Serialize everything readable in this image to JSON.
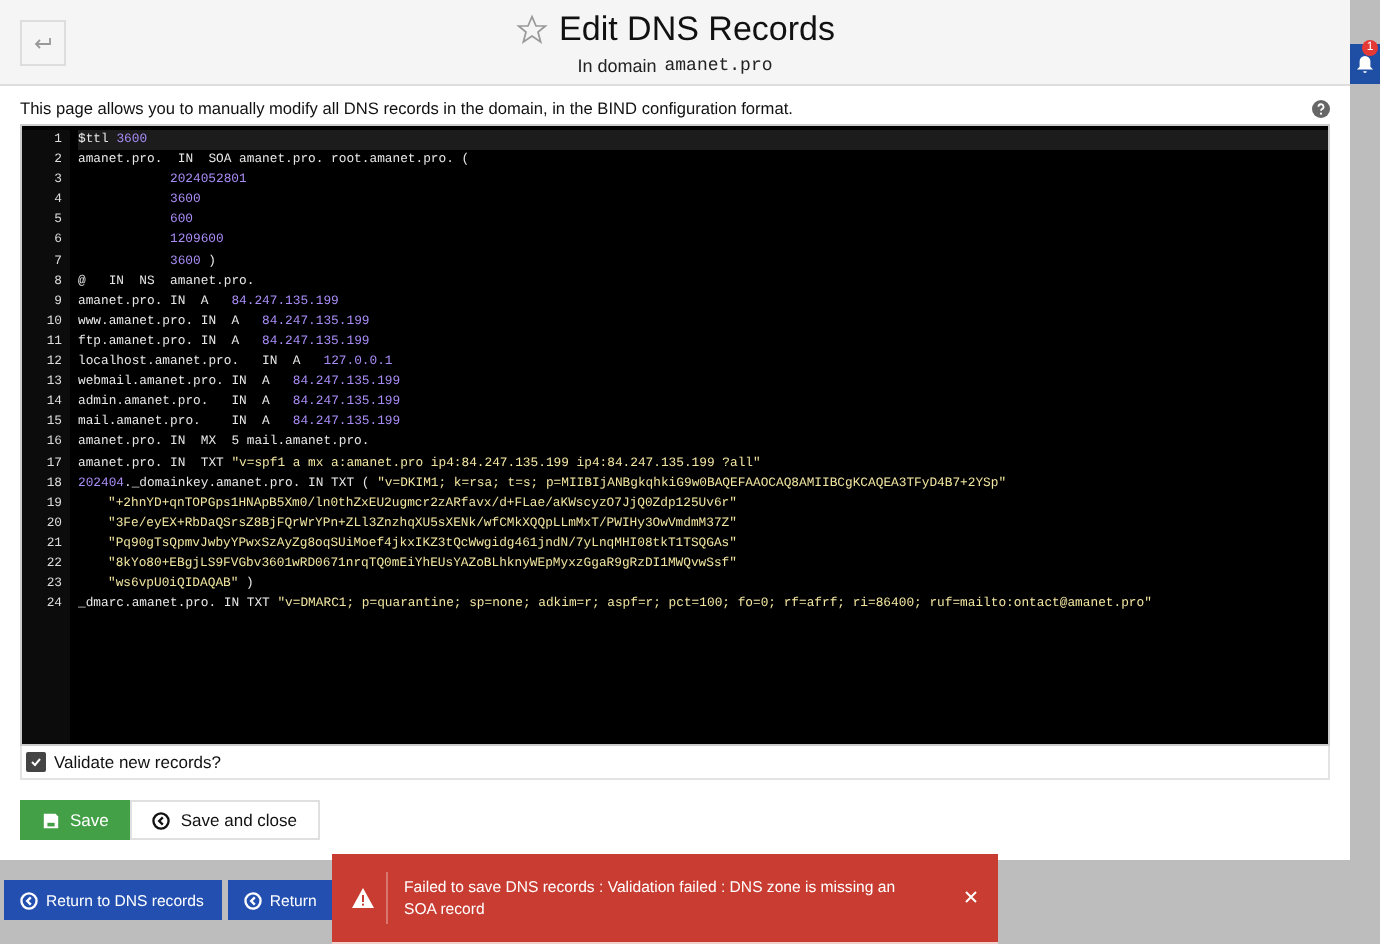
{
  "header": {
    "title": "Edit DNS Records",
    "subtitle_prefix": "In domain",
    "domain": "amanet.pro",
    "favorite": false
  },
  "notifications": {
    "count": "1"
  },
  "description": "This page allows you to manually modify all DNS records in the domain, in the BIND configuration format.",
  "editor": {
    "lines": [
      {
        "number": "1",
        "kind": "record",
        "tokens": [
          {
            "kind": "plain",
            "text": "$ttl "
          },
          {
            "kind": "number",
            "text": "3600"
          }
        ]
      },
      {
        "number": "2",
        "kind": "record",
        "tokens": [
          {
            "kind": "plain",
            "text": "amanet.pro.  IN  SOA amanet.pro. root.amanet.pro. ("
          }
        ]
      },
      {
        "number": "3",
        "kind": "soa_value",
        "tokens": [
          {
            "kind": "number",
            "text": "2024052801"
          }
        ]
      },
      {
        "number": "4",
        "kind": "soa_value",
        "tokens": [
          {
            "kind": "number",
            "text": "3600"
          }
        ]
      },
      {
        "number": "5",
        "kind": "soa_value",
        "tokens": [
          {
            "kind": "number",
            "text": "600"
          }
        ]
      },
      {
        "number": "6",
        "kind": "soa_value",
        "tokens": [
          {
            "kind": "number",
            "text": "1209600"
          }
        ]
      },
      {
        "number": "7",
        "kind": "soa_value",
        "tokens": [
          {
            "kind": "number",
            "text": "3600"
          },
          {
            "kind": "plain",
            "text": " )"
          }
        ]
      },
      {
        "number": "8",
        "kind": "record",
        "tokens": [
          {
            "kind": "plain",
            "text": "@   IN  NS  amanet.pro."
          }
        ]
      },
      {
        "number": "9",
        "kind": "record",
        "tokens": [
          {
            "kind": "plain",
            "text": "amanet.pro. IN  A   "
          },
          {
            "kind": "number",
            "text": "84.247.135.199"
          }
        ]
      },
      {
        "number": "10",
        "kind": "record",
        "tokens": [
          {
            "kind": "plain",
            "text": "www.amanet.pro. IN  A   "
          },
          {
            "kind": "number",
            "text": "84.247.135.199"
          }
        ]
      },
      {
        "number": "11",
        "kind": "record",
        "tokens": [
          {
            "kind": "plain",
            "text": "ftp.amanet.pro. IN  A   "
          },
          {
            "kind": "number",
            "text": "84.247.135.199"
          }
        ]
      },
      {
        "number": "12",
        "kind": "record",
        "tokens": [
          {
            "kind": "plain",
            "text": "localhost.amanet.pro.   IN  A   "
          },
          {
            "kind": "number",
            "text": "127.0.0.1"
          }
        ]
      },
      {
        "number": "13",
        "kind": "record",
        "tokens": [
          {
            "kind": "plain",
            "text": "webmail.amanet.pro. IN  A   "
          },
          {
            "kind": "number",
            "text": "84.247.135.199"
          }
        ]
      },
      {
        "number": "14",
        "kind": "record",
        "tokens": [
          {
            "kind": "plain",
            "text": "admin.amanet.pro.   IN  A   "
          },
          {
            "kind": "number",
            "text": "84.247.135.199"
          }
        ]
      },
      {
        "number": "15",
        "kind": "record",
        "tokens": [
          {
            "kind": "plain",
            "text": "mail.amanet.pro.    IN  A   "
          },
          {
            "kind": "number",
            "text": "84.247.135.199"
          }
        ]
      },
      {
        "number": "16",
        "kind": "record",
        "tokens": [
          {
            "kind": "plain",
            "text": "amanet.pro. IN  MX  5 mail.amanet.pro."
          }
        ]
      },
      {
        "number": "17",
        "kind": "record",
        "tokens": [
          {
            "kind": "plain",
            "text": "amanet.pro. IN  TXT "
          },
          {
            "kind": "string",
            "text": "\"v=spf1 a mx a:amanet.pro ip4:84.247.135.199 ip4:84.247.135.199 ?all\""
          }
        ]
      },
      {
        "number": "18",
        "kind": "record",
        "tokens": [
          {
            "kind": "number",
            "text": "202404"
          },
          {
            "kind": "plain",
            "text": "._domainkey.amanet.pro. IN TXT ( "
          },
          {
            "kind": "string",
            "text": "\"v=DKIM1; k=rsa; t=s; p=MIIBIjANBgkqhkiG9w0BAQEFAAOCAQ8AMIIBCgKCAQEA3TFyD4B7+2YSp\""
          }
        ]
      },
      {
        "number": "19",
        "kind": "continuation",
        "tokens": [
          {
            "kind": "string",
            "text": "\"+2hnYD+qnTOPGps1HNApB5Xm0/ln0thZxEU2ugmcr2zARfavx/d+FLae/aKWscyzO7JjQ0Zdp125Uv6r\""
          }
        ]
      },
      {
        "number": "20",
        "kind": "continuation",
        "tokens": [
          {
            "kind": "string",
            "text": "\"3Fe/eyEX+RbDaQSrsZ8BjFQrWrYPn+ZLl3ZnzhqXU5sXENk/wfCMkXQQpLLmMxT/PWIHy3OwVmdmM37Z\""
          }
        ]
      },
      {
        "number": "21",
        "kind": "continuation",
        "tokens": [
          {
            "kind": "string",
            "text": "\"Pq90gTsQpmvJwbyYPwxSzAyZg8oqSUiMoef4jkxIKZ3tQcWwgidg461jndN/7yLnqMHI08tkT1TSQGAs\""
          }
        ]
      },
      {
        "number": "22",
        "kind": "continuation",
        "tokens": [
          {
            "kind": "string",
            "text": "\"8kYo80+EBgjLS9FVGbv3601wRD0671nrqTQ0mEiYhEUsYAZoBLhknyWEpMyxzGgaR9gRzDI1MWQvwSsf\""
          }
        ]
      },
      {
        "number": "23",
        "kind": "continuation",
        "tokens": [
          {
            "kind": "string",
            "text": "\"ws6vpU0iQIDAQAB\""
          },
          {
            "kind": "plain",
            "text": " )"
          }
        ]
      },
      {
        "number": "24",
        "kind": "record",
        "tokens": [
          {
            "kind": "plain",
            "text": "_dmarc.amanet.pro. IN TXT "
          },
          {
            "kind": "string",
            "text": "\"v=DMARC1; p=quarantine; sp=none; adkim=r; aspf=r; pct=100; fo=0; rf=afrf; ri=86400; ruf=mailto:ontact@amanet.pro\""
          }
        ]
      }
    ]
  },
  "validate": {
    "label": "Validate new records?",
    "checked": true
  },
  "actions": [
    {
      "kind": "save",
      "label": "Save"
    },
    {
      "kind": "save_close",
      "label": "Save and close"
    }
  ],
  "footer_buttons": [
    "Return to DNS records",
    "Return"
  ],
  "toast": {
    "message": "Failed to save DNS records : Validation failed : DNS zone is missing an SOA record"
  }
}
